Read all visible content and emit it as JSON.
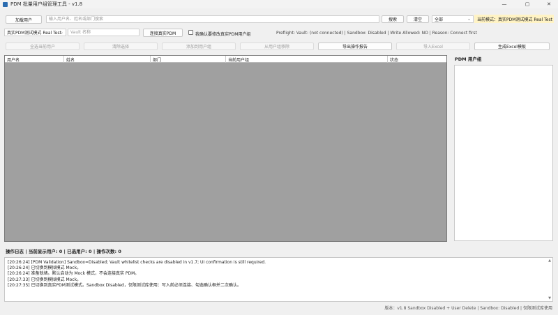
{
  "window": {
    "title": "PDM 批量用户组管理工具 - v1.8",
    "minimize": "—",
    "maximize": "▢",
    "close": "✕"
  },
  "toolbar": {
    "load_users": "加载用户",
    "search_placeholder": "输入用户名、姓名或部门搜索",
    "search": "搜索",
    "clear": "清空",
    "filter_value": "全部",
    "mode_badge": "当前模式：真实PDM测试模式 Real Test"
  },
  "connection": {
    "mode_value": "真实PDM测试模式 Real Test",
    "vault_placeholder": "Vault 名称",
    "connect": "连接真实PDM",
    "confirm_checkbox_label": "我确认要修改真实PDM用户组",
    "preflight": "Preflight: Vault: (not connected) | Sandbox: Disabled | Write Allowed: NO | Reason: Connect first"
  },
  "actions": {
    "select_all": "全选当前用户",
    "clear_selection": "清除选择",
    "add_to_group": "添加到用户组",
    "remove_from_group": "从用户组移除",
    "export_report": "导出操作报告",
    "import_excel": "导入Excel",
    "generate_template": "生成Excel模板"
  },
  "table": {
    "columns": [
      "用户名",
      "姓名",
      "部门",
      "当前用户组",
      "状态"
    ]
  },
  "side": {
    "title": "PDM 用户组"
  },
  "status": {
    "summary": "操作日志 | 当前显示用户: 0 | 已选用户: 0 | 操作次数: 0"
  },
  "log": {
    "lines": [
      "[20:26:24] [PDM Validation] Sandbox=Disabled; Vault whitelist checks are disabled in v1.7; UI confirmation is still required.",
      "[20:26:24] 已切换到模拟模式 Mock。",
      "[20:26:24] 准备就绪。默认启动为 Mock 模式，不会连接真实 PDM。",
      "[20:27:33] 已切换到模拟模式 Mock。",
      "[20:27:35] 已切换到真实PDM测试模式。Sandbox Disabled，仅限测试库使用：写入前必须连接、勾选确认框并二次确认。"
    ]
  },
  "footer": {
    "version": "版本：v1.8 Sandbox Disabled + User Delete | Sandbox: Disabled | 仅限测试库使用"
  }
}
